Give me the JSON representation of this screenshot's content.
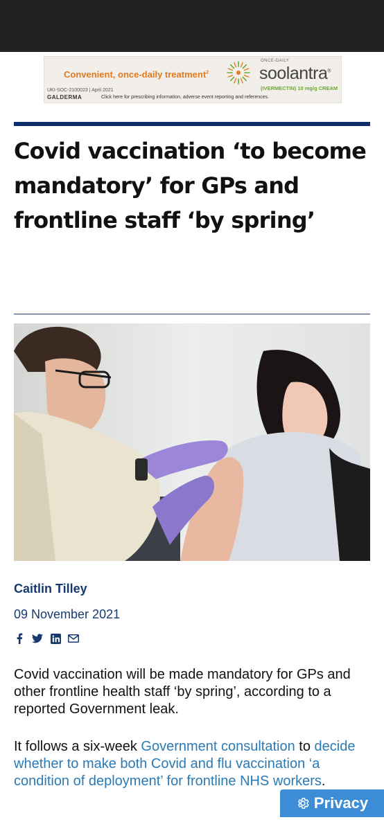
{
  "ad": {
    "tagline": "Convenient, once-daily treatment",
    "tagline_sup": "2",
    "code": "UKI-SOC-2100023 | April 2021",
    "company": "GALDERMA",
    "note": "Click here for prescribing information, adverse event reporting and references.",
    "once_daily": "ONCE-DAILY",
    "brand": "soolantra",
    "brand_mark": "®",
    "generic": "(IVERMECTIN) 10 mg/g CREAM",
    "colors": {
      "tagline": "#e07a1c",
      "generic": "#6aa832"
    }
  },
  "article": {
    "headline": "Covid vaccination ‘to become mandatory’ for GPs and frontline staff ‘by spring’",
    "author": "Caitlin Tilley",
    "date": "09 November 2021",
    "share_icons": [
      "facebook-icon",
      "twitter-icon",
      "linkedin-icon",
      "email-icon"
    ],
    "paragraph1": "Covid vaccination will be made mandatory for GPs and other frontline health staff ‘by spring’, according to a reported Government leak.",
    "paragraph2": {
      "t1": "It follows a six-week ",
      "link1": "Government consultation",
      "t2": " to ",
      "link2": "decide whether to make both Covid and flu vaccination ‘a condition of deployment’ for frontline NHS workers",
      "t3": "."
    },
    "colors": {
      "accent": "#0f2f6b",
      "byline": "#163a70",
      "link": "#2a7ab5"
    }
  },
  "privacy": {
    "label": "Privacy",
    "icon": "gear-icon",
    "color": "#3d8dd6"
  }
}
